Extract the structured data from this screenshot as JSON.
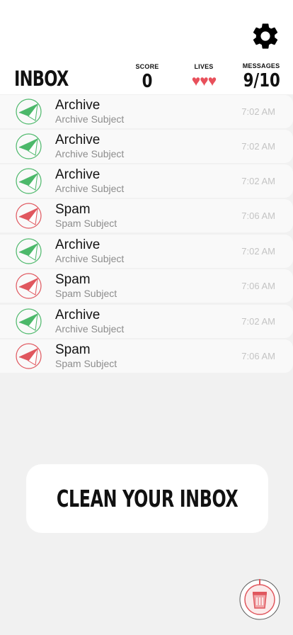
{
  "header": {
    "title": "INBOX",
    "score_label": "SCORE",
    "score_value": "0",
    "lives_label": "LIVES",
    "lives_hearts": "♥♥♥",
    "lives_count": 3,
    "messages_label": "MESSAGES",
    "messages_value": "9/10"
  },
  "colors": {
    "archive": "#4cb86a",
    "spam": "#e0575e",
    "heart": "#e8505b"
  },
  "messages": [
    {
      "kind": "archive",
      "title": "Archive",
      "subject": "Archive Subject",
      "time": "7:02 AM"
    },
    {
      "kind": "archive",
      "title": "Archive",
      "subject": "Archive Subject",
      "time": "7:02 AM"
    },
    {
      "kind": "archive",
      "title": "Archive",
      "subject": "Archive Subject",
      "time": "7:02 AM"
    },
    {
      "kind": "spam",
      "title": "Spam",
      "subject": "Spam Subject",
      "time": "7:06 AM"
    },
    {
      "kind": "archive",
      "title": "Archive",
      "subject": "Archive Subject",
      "time": "7:02 AM"
    },
    {
      "kind": "spam",
      "title": "Spam",
      "subject": "Spam Subject",
      "time": "7:06 AM"
    },
    {
      "kind": "archive",
      "title": "Archive",
      "subject": "Archive Subject",
      "time": "7:02 AM"
    },
    {
      "kind": "spam",
      "title": "Spam",
      "subject": "Spam Subject",
      "time": "7:06 AM"
    }
  ],
  "cta": {
    "label": "CLEAN YOUR INBOX"
  },
  "icons": {
    "settings": "gear-icon",
    "badge": "trash-badge-icon",
    "row": "paper-plane-icon"
  }
}
